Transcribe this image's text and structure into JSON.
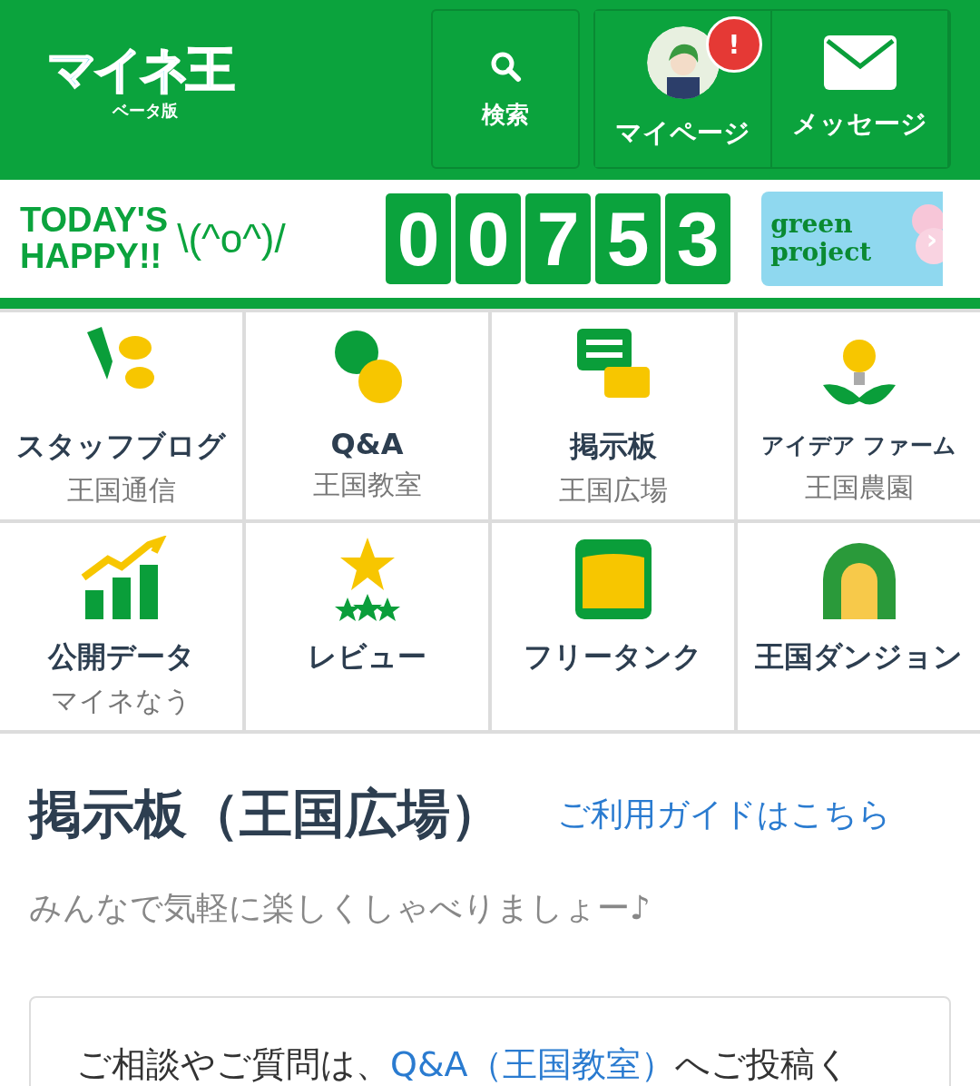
{
  "header": {
    "logo": "マイネ王",
    "logo_sub": "ベータ版",
    "search": {
      "label": "検索"
    },
    "mypage": {
      "label": "マイページ",
      "badge": "!"
    },
    "messages": {
      "label": "メッセージ"
    }
  },
  "banner": {
    "line1": "TODAY'S",
    "line2": "HAPPY!!",
    "kaomoji": "\\(^o^)/",
    "counter": [
      "0",
      "0",
      "7",
      "5",
      "3"
    ],
    "promo_line1": "green",
    "promo_line2": "project",
    "promo_arrow": "›"
  },
  "menu": [
    {
      "title": "スタッフブログ",
      "subtitle": "王国通信"
    },
    {
      "title": "Q&A",
      "subtitle": "王国教室"
    },
    {
      "title": "掲示板",
      "subtitle": "王国広場"
    },
    {
      "title": "アイデア ファーム",
      "subtitle": "王国農園"
    },
    {
      "title": "公開データ",
      "subtitle": "マイネなう"
    },
    {
      "title": "レビュー"
    },
    {
      "title": "フリータンク"
    },
    {
      "title": "王国ダンジョン"
    }
  ],
  "section": {
    "title": "掲示板（王国広場）",
    "guide_link": "ご利用ガイドはこちら",
    "description": "みんなで気軽に楽しくしゃべりましょー♪"
  },
  "notice": {
    "before": "ご相談やご質問は、",
    "link": "Q&A（王国教室）",
    "after": "へご投稿く"
  }
}
